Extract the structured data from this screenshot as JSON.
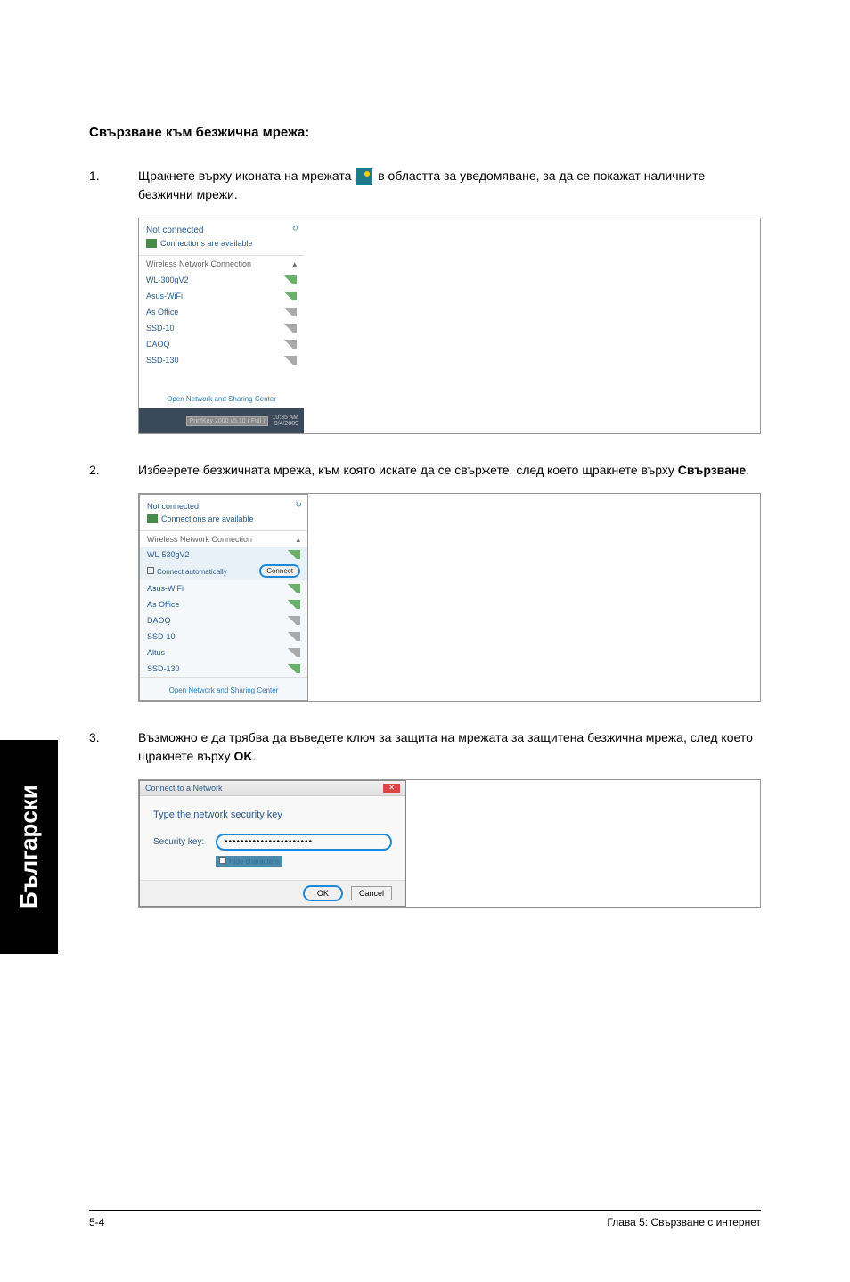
{
  "heading": "Свързване към безжична мрежа:",
  "steps": {
    "s1": {
      "num": "1.",
      "text_before": "Щракнете върху иконата на мрежата ",
      "text_after": " в областта за уведомяване, за да се покажат наличните безжични мрежи."
    },
    "s2": {
      "num": "2.",
      "text": "Избеерете безжичната мрежа, към която искате да се свържете, след което щракнете върху ",
      "bold": "Свързване",
      "suffix": "."
    },
    "s3": {
      "num": "3.",
      "text": "Възможно е да трябва да въведете ключ за защита на мрежата за защитена безжична мрежа, след което щракнете върху ",
      "bold": "OK",
      "suffix": "."
    }
  },
  "shot1": {
    "title": "Not connected",
    "subtitle": "Connections are available",
    "section": "Wireless Network Connection",
    "networks": [
      {
        "name": "WL-300gV2",
        "strength": "green"
      },
      {
        "name": "Asus-WiFi",
        "strength": "green"
      },
      {
        "name": "As Office",
        "strength": "gray"
      },
      {
        "name": "SSD-10",
        "strength": "gray"
      },
      {
        "name": "DAOQ",
        "strength": "gray"
      },
      {
        "name": "SSD-130",
        "strength": "gray"
      }
    ],
    "footer": "Open Network and Sharing Center",
    "taskbar_badge": "PrintKey 2000 v5.10 ( Full )",
    "taskbar_time": "10:35 AM",
    "taskbar_date": "9/4/2009"
  },
  "shot2": {
    "title": "Not connected",
    "subtitle": "Connections are available",
    "section": "Wireless Network Connection",
    "selected": "WL-530gV2",
    "auto_connect": "Connect automatically",
    "connect": "Connect",
    "networks": [
      {
        "name": "Asus-WiFi",
        "strength": "green"
      },
      {
        "name": "As Office",
        "strength": "green"
      },
      {
        "name": "DAOQ",
        "strength": "gray"
      },
      {
        "name": "SSD-10",
        "strength": "gray"
      },
      {
        "name": "Altus",
        "strength": "gray"
      },
      {
        "name": "SSD-130",
        "strength": "green"
      }
    ],
    "footer": "Open Network and Sharing Center"
  },
  "shot3": {
    "title": "Connect to a Network",
    "prompt": "Type the network security key",
    "key_label": "Security key:",
    "key_value": "••••••••••••••••••••••",
    "hide": "Hide characters",
    "ok": "OK",
    "cancel": "Cancel"
  },
  "side_tab": "Български",
  "footer": {
    "left": "5-4",
    "right": "Глава 5: Свързване с интернет"
  }
}
